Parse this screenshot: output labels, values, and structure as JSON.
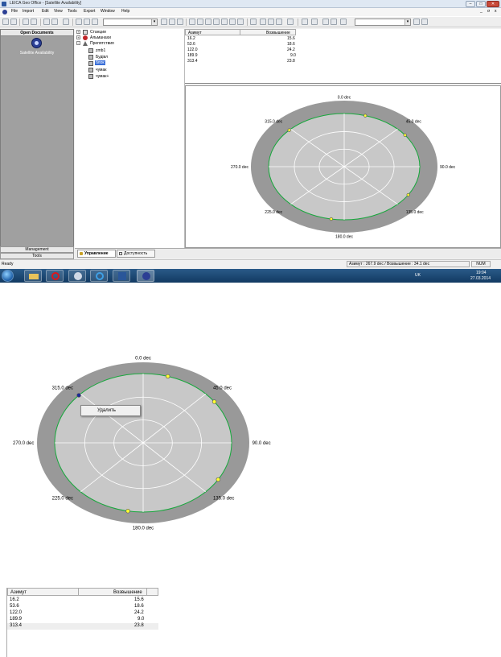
{
  "window": {
    "title": "LEICA Geo Office - [Satellite Availability]",
    "controls": [
      "–",
      "□",
      "✕"
    ],
    "inner_controls": [
      "_",
      "σ",
      "x"
    ]
  },
  "menu": [
    "File",
    "Import",
    "Edit",
    "View",
    "Tools",
    "Export",
    "Window",
    "Help"
  ],
  "left_panel": {
    "header": "Open Documents",
    "item_label": "Satellite Availability",
    "management_label": "Management",
    "tools_label": "Tools"
  },
  "tree": {
    "nodes": [
      {
        "label": "Станции",
        "level": 0
      },
      {
        "label": "Альманахи",
        "level": 0
      },
      {
        "label": "Препятствия",
        "level": 0
      },
      {
        "label": "zmb1",
        "level": 1
      },
      {
        "label": "Будівл",
        "level": 1
      },
      {
        "label": "блок",
        "level": 1,
        "selected": true
      },
      {
        "label": "чумак",
        "level": 1
      },
      {
        "label": "чумак+",
        "level": 1
      }
    ]
  },
  "table": {
    "headers": [
      "Азимут",
      "Возвышение"
    ],
    "rows": [
      [
        "16.2",
        "15.6"
      ],
      [
        "53.6",
        "18.6"
      ],
      [
        "122.0",
        "24.2"
      ],
      [
        "189.9",
        "9.0"
      ],
      [
        "313.4",
        "23.8"
      ]
    ]
  },
  "polar_labels": {
    "n": "0.0 dec",
    "ne": "45.0 dec",
    "e": "90.0 dec",
    "se": "135.0 dec",
    "s": "180.0 dec",
    "sw": "225.0 dec",
    "w": "270.0 dec",
    "nw": "315.0 dec"
  },
  "polar_points": [
    {
      "az": 16.2,
      "el": 15.6
    },
    {
      "az": 53.6,
      "el": 18.6
    },
    {
      "az": 122.0,
      "el": 24.2
    },
    {
      "az": 189.9,
      "el": 9.0
    },
    {
      "az": 313.4,
      "el": 23.8
    }
  ],
  "colors": {
    "outer_ring": "#999999",
    "inner_disk": "#c8c8c8",
    "grid": "#ffffff",
    "horizon_line": "#16a83b",
    "point_fill": "#ffff33",
    "selected_point": "#1b2a9a"
  },
  "tabs": [
    "Управление",
    "Доступность"
  ],
  "status": {
    "ready": "Ready",
    "readout": "Азимут : 267.9 dec / Возвышение : 34.1 dec",
    "num": "NUM"
  },
  "taskbar": {
    "lang": "UK",
    "time": "19:04",
    "date": "27.03.2014"
  },
  "context_menu": {
    "item": "Удалить"
  }
}
